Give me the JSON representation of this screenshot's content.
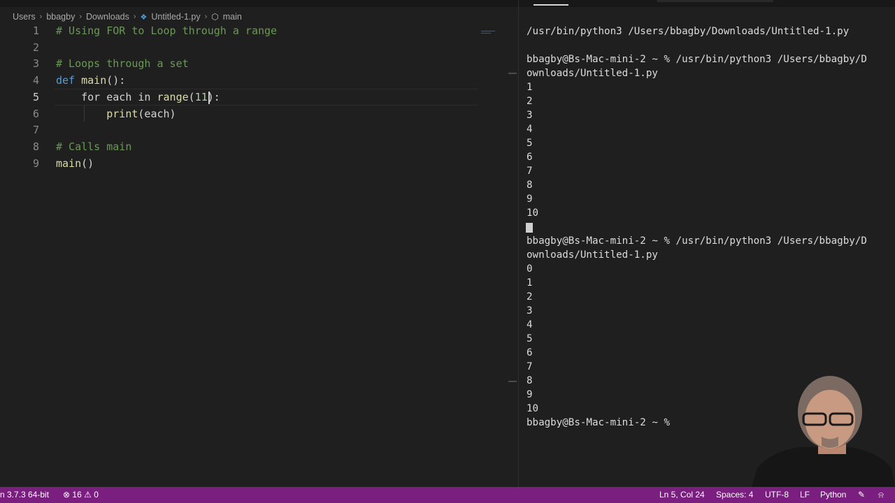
{
  "breadcrumb": {
    "items": [
      "Users",
      "bbagby",
      "Downloads",
      "Untitled-1.py",
      "main"
    ]
  },
  "editor": {
    "lines": [
      {
        "n": "1",
        "segments": [
          {
            "t": "# Using FOR to Loop through a range",
            "c": "cm"
          }
        ]
      },
      {
        "n": "2",
        "segments": []
      },
      {
        "n": "3",
        "segments": [
          {
            "t": "# Loops through a set",
            "c": "cm"
          }
        ]
      },
      {
        "n": "4",
        "segments": [
          {
            "t": "def",
            "c": "kw"
          },
          {
            "t": " ",
            "c": "df"
          },
          {
            "t": "main",
            "c": "fn"
          },
          {
            "t": "():",
            "c": "df"
          }
        ]
      },
      {
        "n": "5",
        "segments": [
          {
            "t": "    for each in ",
            "c": "df"
          },
          {
            "t": "range",
            "c": "fn"
          },
          {
            "t": "(",
            "c": "df"
          },
          {
            "t": "11",
            "c": "num"
          },
          {
            "t": "):",
            "c": "df"
          }
        ]
      },
      {
        "n": "6",
        "segments": [
          {
            "t": "        ",
            "c": "df"
          },
          {
            "t": "print",
            "c": "fn"
          },
          {
            "t": "(each)",
            "c": "df"
          }
        ]
      },
      {
        "n": "7",
        "segments": []
      },
      {
        "n": "8",
        "segments": [
          {
            "t": "# Calls main",
            "c": "cm"
          }
        ]
      },
      {
        "n": "9",
        "segments": [
          {
            "t": "main",
            "c": "fn"
          },
          {
            "t": "()",
            "c": "df"
          }
        ]
      }
    ]
  },
  "terminal": {
    "lines": [
      "/usr/bin/python3 /Users/bbagby/Downloads/Untitled-1.py",
      "",
      "bbagby@Bs-Mac-mini-2 ~ % /usr/bin/python3 /Users/bbagby/D",
      "ownloads/Untitled-1.py",
      "1",
      "2",
      "3",
      "4",
      "5",
      "6",
      "7",
      "8",
      "9",
      "10",
      "",
      "bbagby@Bs-Mac-mini-2 ~ % /usr/bin/python3 /Users/bbagby/D",
      "ownloads/Untitled-1.py",
      "0",
      "1",
      "2",
      "3",
      "4",
      "5",
      "6",
      "7",
      "8",
      "9",
      "10",
      "bbagby@Bs-Mac-mini-2 ~ % "
    ]
  },
  "statusbar": {
    "interpreter": "n 3.7.3 64-bit",
    "errors": "16",
    "warnings": "0",
    "position": "Ln 5, Col 24",
    "spaces": "Spaces: 4",
    "encoding": "UTF-8",
    "eol": "LF",
    "language": "Python"
  },
  "colors": {
    "statusbar": "#7a1e80",
    "background": "#1f1f1f",
    "comment": "#6a9955",
    "keyword": "#569cd6",
    "function": "#dcdcaa",
    "number": "#b5cea8"
  },
  "icons": [
    "python-file-icon",
    "symbol-method-icon",
    "error-icon",
    "warning-icon",
    "feedback-icon",
    "bell-icon"
  ]
}
